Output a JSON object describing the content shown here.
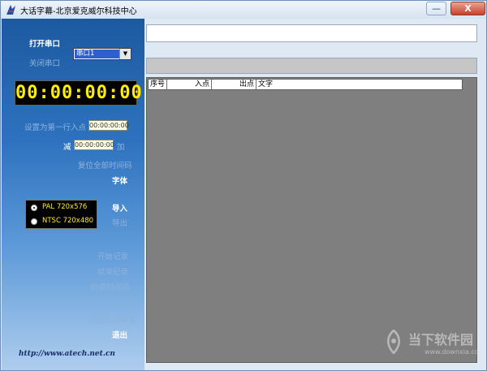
{
  "window": {
    "title": "大话字幕-北京爱克威尔科技中心",
    "minimize_glyph": "—",
    "close_glyph": "X"
  },
  "sidebar": {
    "open_port": "打开串口",
    "close_port": "关闭串口",
    "port_select": {
      "selected": "串口1",
      "arrow": "▼"
    },
    "timecode": "00:00:00:00",
    "set_first_in": "设置为第一行入点",
    "first_in_value": "00:00:00:00",
    "subtract": "减",
    "add": "加",
    "offset_value": "00:00:00:00",
    "reset_all": "复位全部时间码",
    "font": "字体",
    "video_formats": [
      {
        "label": "PAL 720x576",
        "selected": true
      },
      {
        "label": "NTSC 720x480",
        "selected": false
      }
    ],
    "import": "导入",
    "export": "导出",
    "start_record": "开始记录",
    "stop_record": "结束纪录",
    "check_timecode": "检查时间码",
    "output_dvd": "输出DVD字幕",
    "exit": "退出",
    "website": "http://www.atech.net.cn"
  },
  "main": {
    "subtitle_input_value": "",
    "status_value": "",
    "table": {
      "columns": [
        "序号",
        "入点",
        "出点",
        "文字"
      ],
      "rows": []
    }
  },
  "watermark": {
    "name": "当下软件园",
    "url": "www.downxia.com"
  },
  "colors": {
    "timecode_fg": "#ffee00",
    "sidebar_top": "#1c5aa0",
    "sidebar_bottom": "#aecdee",
    "grid_bg": "#7f7f7f"
  }
}
